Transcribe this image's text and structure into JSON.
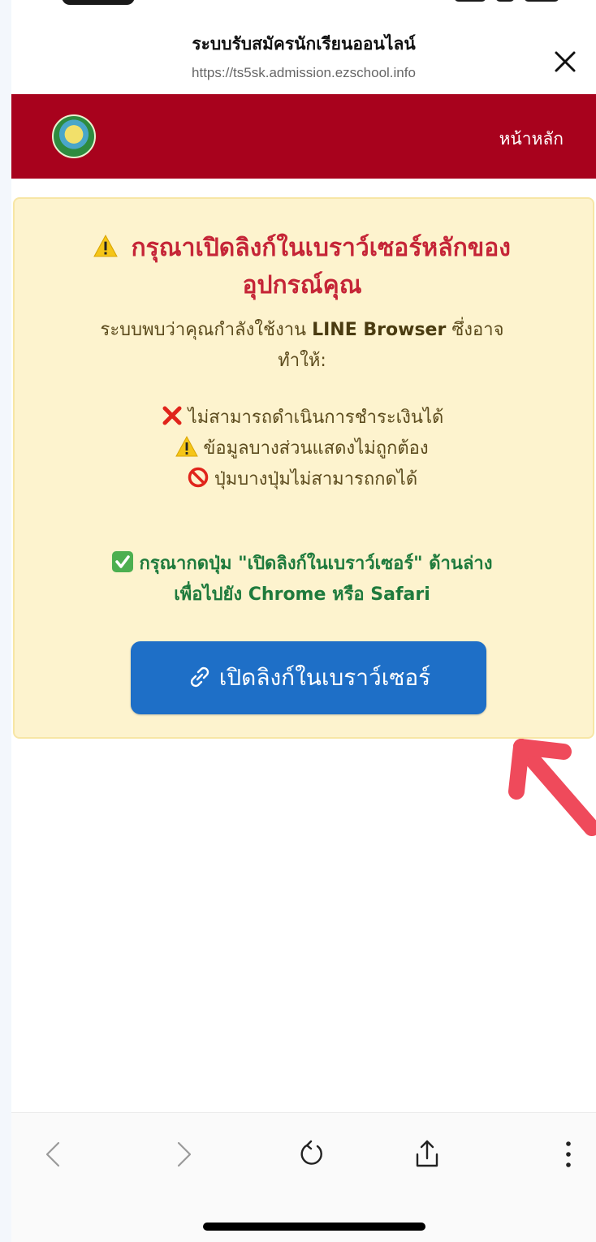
{
  "browser": {
    "title": "ระบบรับสมัครนักเรียนออนไลน์",
    "url": "https://ts5sk.admission.ezschool.info",
    "close_icon": "close-icon"
  },
  "navbar": {
    "logo_icon": "school-logo",
    "home_label": "หน้าหลัก",
    "background": "#a8021d"
  },
  "warning": {
    "title_icon": "warning-icon",
    "title_line1": "กรุณาเปิดลิงก์ในเบราว์เซอร์หลักของ",
    "title_line2": "อุปกรณ์คุณ",
    "desc_prefix": "ระบบพบว่าคุณกำลังใช้งาน",
    "desc_browser": "LINE Browser",
    "desc_suffix": "ซึ่งอาจ",
    "desc_line2": "ทำให้:",
    "issues": [
      {
        "icon": "cross-mark-icon",
        "text": "ไม่สามารถดำเนินการชำระเงินได้"
      },
      {
        "icon": "warning-icon",
        "text": "ข้อมูลบางส่วนแสดงไม่ถูกต้อง"
      },
      {
        "icon": "prohibited-icon",
        "text": "ปุ่มบางปุ่มไม่สามารถกดได้"
      }
    ],
    "instruction_icon": "check-mark-icon",
    "instruction_line1": "กรุณากดปุ่ม \"เปิดลิงก์ในเบราว์เซอร์\" ด้านล่าง",
    "instruction_line2": "เพื่อไปยัง Chrome หรือ Safari",
    "button_icon": "link-icon",
    "button_label": "เปิดลิงก์ในเบราว์เซอร์"
  },
  "toolbar": {
    "back_icon": "back-chevron-icon",
    "forward_icon": "forward-chevron-icon",
    "reload_icon": "reload-icon",
    "share_icon": "share-icon",
    "more_icon": "more-vertical-icon"
  },
  "colors": {
    "card_background": "#fdf3ce",
    "title": "#c52537",
    "instruction": "#1e7a3c",
    "button": "#1e6fc7",
    "arrow": "#ef4a5b"
  }
}
